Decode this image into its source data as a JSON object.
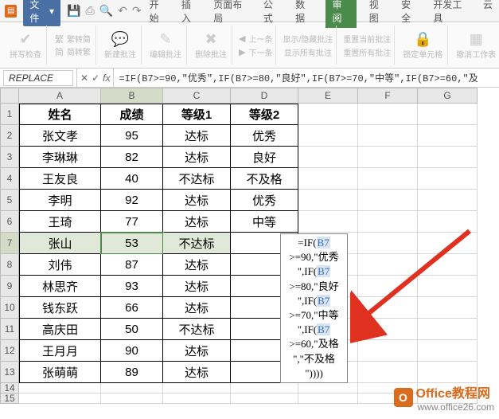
{
  "menubar": {
    "file": "文件",
    "tabs": [
      "开始",
      "插入",
      "页面布局",
      "公式",
      "数据",
      "审阅",
      "视图",
      "安全",
      "开发工具",
      "云"
    ],
    "active_tab": "审阅"
  },
  "ribbon": {
    "g1": "拼写检查",
    "g2a": "繁转简",
    "g2b": "简转繁",
    "g3": "新建批注",
    "g4": "编辑批注",
    "g5": "删除批注",
    "g6a": "上一条",
    "g6b": "下一条",
    "g7a": "显示/隐藏批注",
    "g7b": "显示所有批注",
    "g8a": "重置当前批注",
    "g8b": "重置所有批注",
    "g9": "锁定单元格",
    "g10": "撤消工作表"
  },
  "formula_bar": {
    "name_box": "REPLACE",
    "formula": "=IF(B7>=90,\"优秀\",IF(B7>=80,\"良好\",IF(B7>=70,\"中等\",IF(B7>=60,\"及"
  },
  "columns": [
    "A",
    "B",
    "C",
    "D",
    "E",
    "F",
    "G"
  ],
  "rows": [
    "1",
    "2",
    "3",
    "4",
    "5",
    "6",
    "7",
    "8",
    "9",
    "10",
    "11",
    "12",
    "13",
    "14",
    "15"
  ],
  "table": {
    "headers": [
      "姓名",
      "成绩",
      "等级1",
      "等级2"
    ],
    "data": [
      [
        "张文孝",
        "95",
        "达标",
        "优秀"
      ],
      [
        "李琳琳",
        "82",
        "达标",
        "良好"
      ],
      [
        "王友良",
        "40",
        "不达标",
        "不及格"
      ],
      [
        "李明",
        "92",
        "达标",
        "优秀"
      ],
      [
        "王琦",
        "77",
        "达标",
        "中等"
      ],
      [
        "张山",
        "53",
        "不达标",
        ""
      ],
      [
        "刘伟",
        "87",
        "达标",
        ""
      ],
      [
        "林思齐",
        "93",
        "达标",
        ""
      ],
      [
        "钱东跃",
        "66",
        "达标",
        ""
      ],
      [
        "高庆田",
        "50",
        "不达标",
        ""
      ],
      [
        "王月月",
        "90",
        "达标",
        ""
      ],
      [
        "张萌萌",
        "89",
        "达标",
        ""
      ]
    ]
  },
  "formula_overlay": {
    "l1a": "=IF(",
    "l1b": "B7",
    "l2": ">=90,\"优秀",
    "l3a": "\",IF(",
    "l3b": "B7",
    "l4": ">=80,\"良好",
    "l5a": "\",IF(",
    "l5b": "B7",
    "l6": ">=70,\"中等",
    "l7a": "\",IF(",
    "l7b": "B7",
    "l8": ">=60,\"及格",
    "l9": "\",\"不及格",
    "l10": "\"))))"
  },
  "watermark": {
    "brand": "Office教程网",
    "url": "www.office26.com"
  }
}
